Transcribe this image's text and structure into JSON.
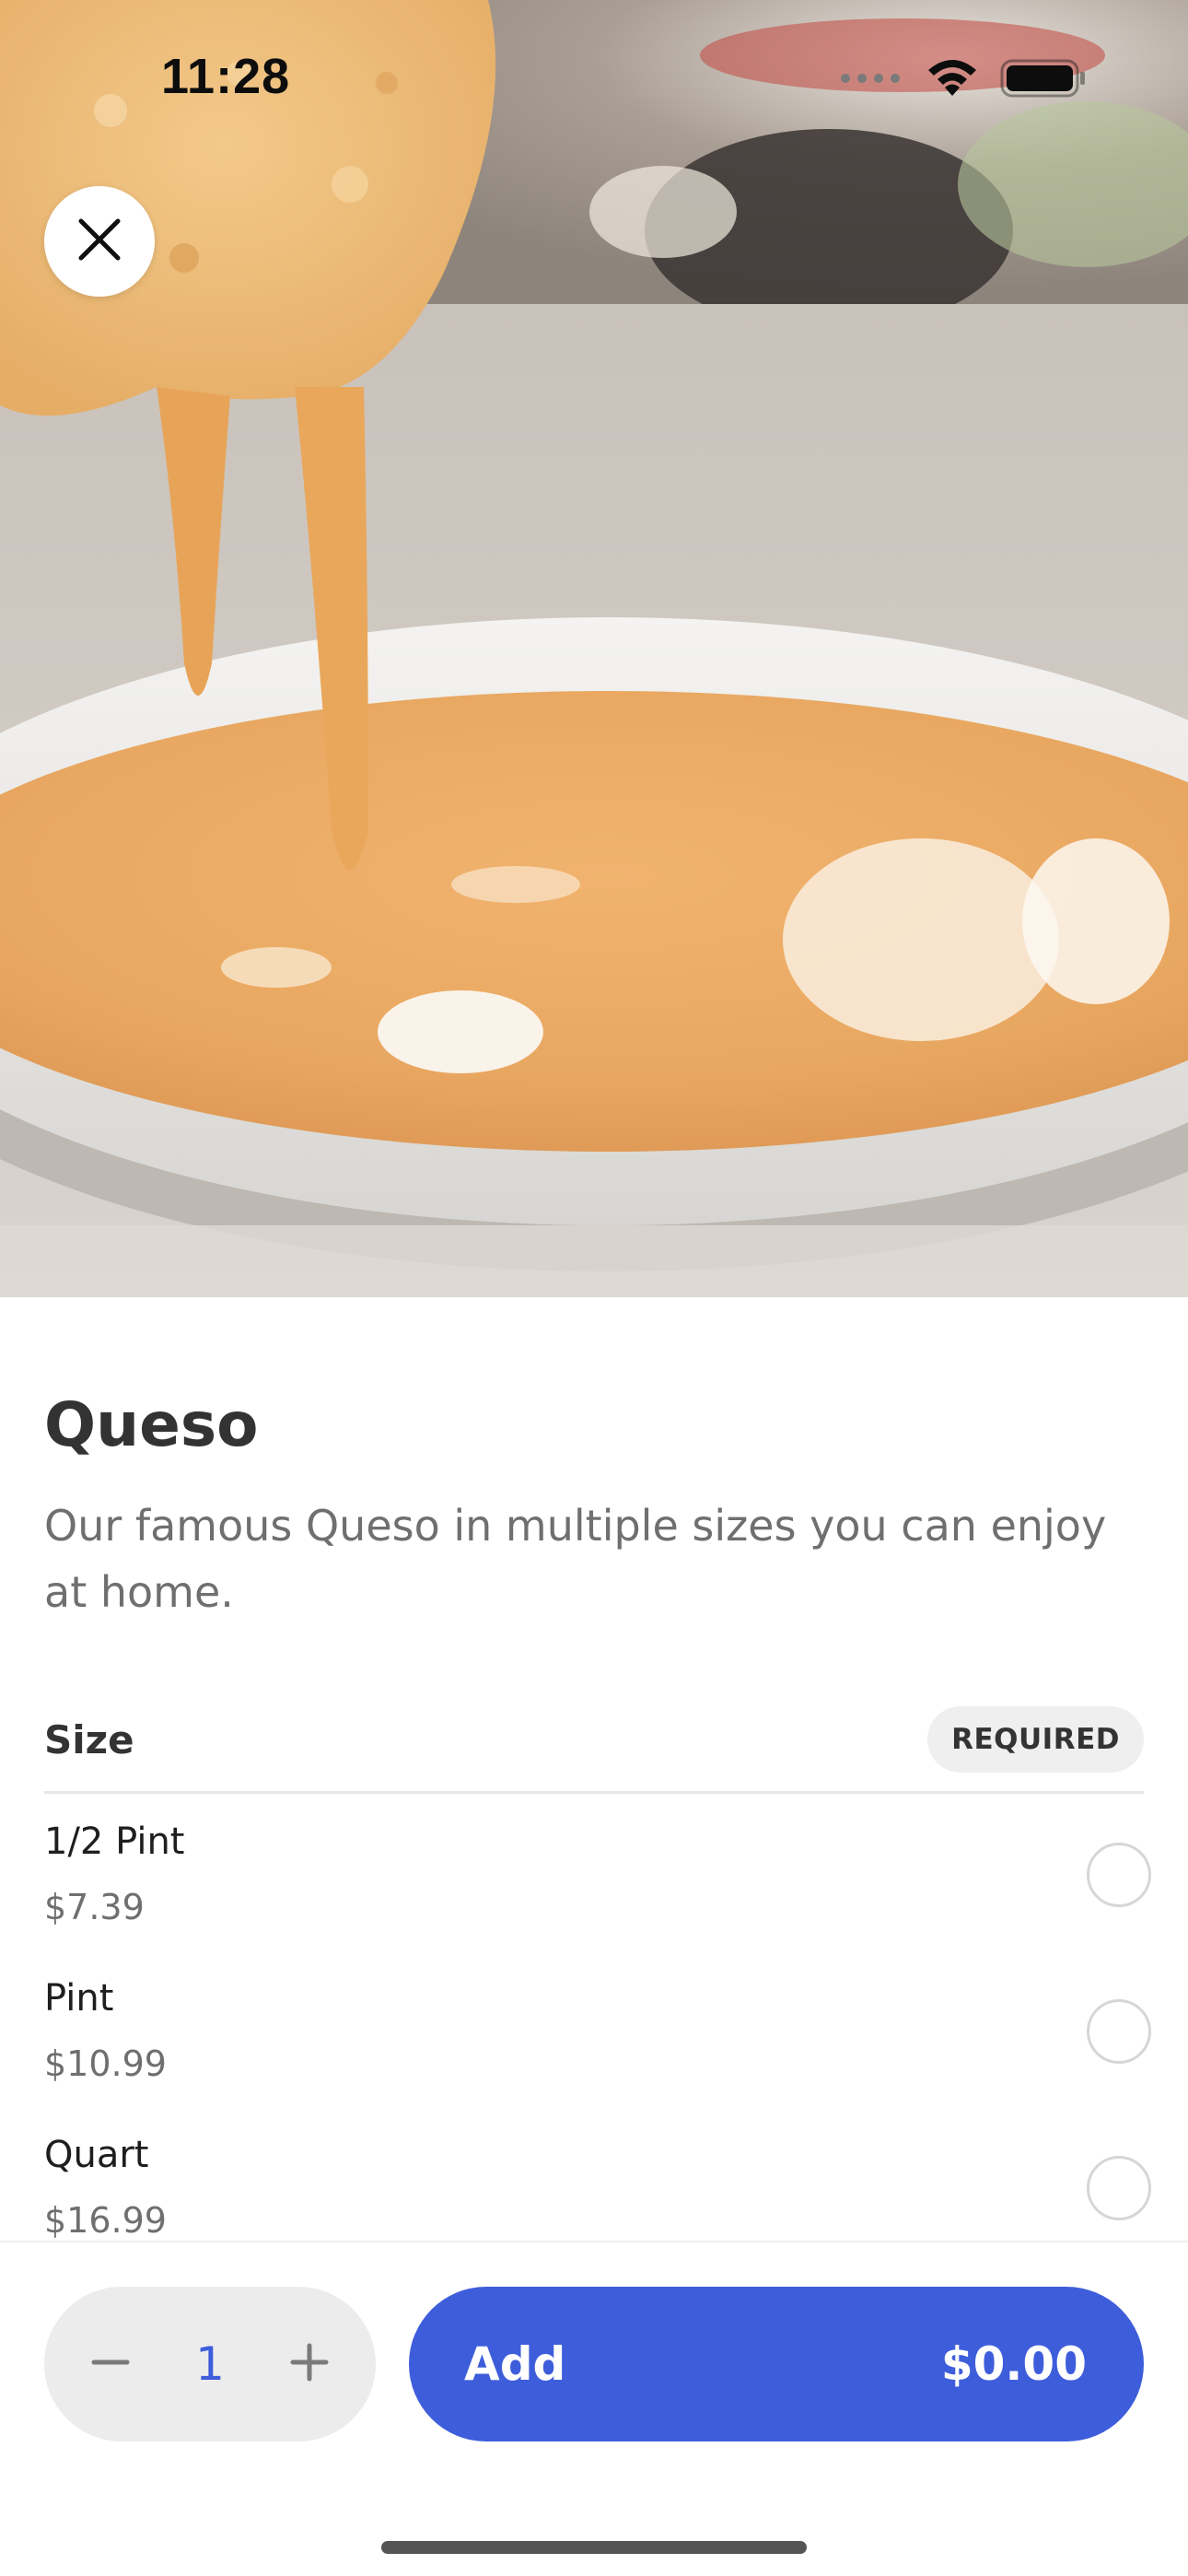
{
  "status_bar": {
    "time": "11:28"
  },
  "hero": {
    "image_alt": "queso dip photo"
  },
  "item": {
    "title": "Queso",
    "description": "Our famous Queso in multiple sizes you can enjoy at home."
  },
  "size_section": {
    "title": "Size",
    "badge": "REQUIRED",
    "options": [
      {
        "name": "1/2 Pint",
        "price": "$7.39",
        "selected": false
      },
      {
        "name": "Pint",
        "price": "$10.99",
        "selected": false
      },
      {
        "name": "Quart",
        "price": "$16.99",
        "selected": false
      }
    ]
  },
  "cart": {
    "quantity": "1",
    "add_label": "Add",
    "add_price": "$0.00"
  },
  "colors": {
    "accent": "#3e5ddb",
    "stepper_bg": "#ececec",
    "badge_bg": "#efefef"
  },
  "icons": [
    "close-icon",
    "signal-icon",
    "wifi-icon",
    "battery-icon",
    "minus-icon",
    "plus-icon"
  ]
}
